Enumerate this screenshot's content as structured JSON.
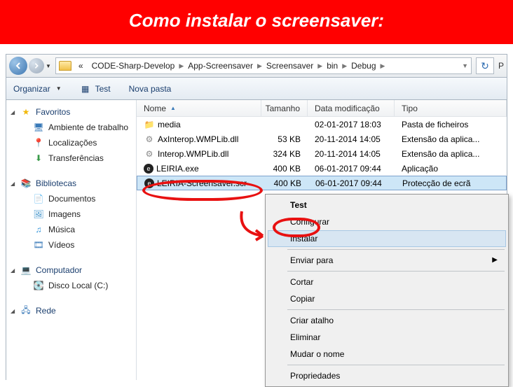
{
  "banner": "Como instalar o screensaver:",
  "breadcrumb": [
    "CODE-Sharp-Develop",
    "App-Screensaver",
    "Screensaver",
    "bin",
    "Debug"
  ],
  "breadcrumb_leading": "«",
  "toolbar": {
    "organize": "Organizar",
    "test": "Test",
    "new_folder": "Nova pasta"
  },
  "address_cutoff": "P",
  "sidebar": {
    "favorites": {
      "label": "Favoritos",
      "items": [
        "Ambiente de trabalho",
        "Localizações",
        "Transferências"
      ]
    },
    "libraries": {
      "label": "Bibliotecas",
      "items": [
        "Documentos",
        "Imagens",
        "Música",
        "Vídeos"
      ]
    },
    "computer": {
      "label": "Computador",
      "items": [
        "Disco Local (C:)"
      ]
    },
    "network": {
      "label": "Rede"
    }
  },
  "columns": {
    "name": "Nome",
    "size": "Tamanho",
    "date": "Data modificação",
    "type": "Tipo"
  },
  "rows": [
    {
      "name": "media",
      "size": "",
      "date": "02-01-2017 18:03",
      "type": "Pasta de ficheiros",
      "icon": "folder"
    },
    {
      "name": "AxInterop.WMPLib.dll",
      "size": "53 KB",
      "date": "20-11-2014 14:05",
      "type": "Extensão da aplica...",
      "icon": "dll"
    },
    {
      "name": "Interop.WMPLib.dll",
      "size": "324 KB",
      "date": "20-11-2014 14:05",
      "type": "Extensão da aplica...",
      "icon": "dll"
    },
    {
      "name": "LEIRIA.exe",
      "size": "400 KB",
      "date": "06-01-2017 09:44",
      "type": "Aplicação",
      "icon": "exe"
    },
    {
      "name": "LEIRIA-Screensaver.scr",
      "size": "400 KB",
      "date": "06-01-2017 09:44",
      "type": "Protecção de ecrã",
      "icon": "exe",
      "selected": true
    }
  ],
  "context_menu": {
    "test": "Test",
    "configure": "Configurar",
    "install": "Instalar",
    "send_to": "Enviar para",
    "cut": "Cortar",
    "copy": "Copiar",
    "shortcut": "Criar atalho",
    "delete": "Eliminar",
    "rename": "Mudar o nome",
    "properties": "Propriedades"
  }
}
